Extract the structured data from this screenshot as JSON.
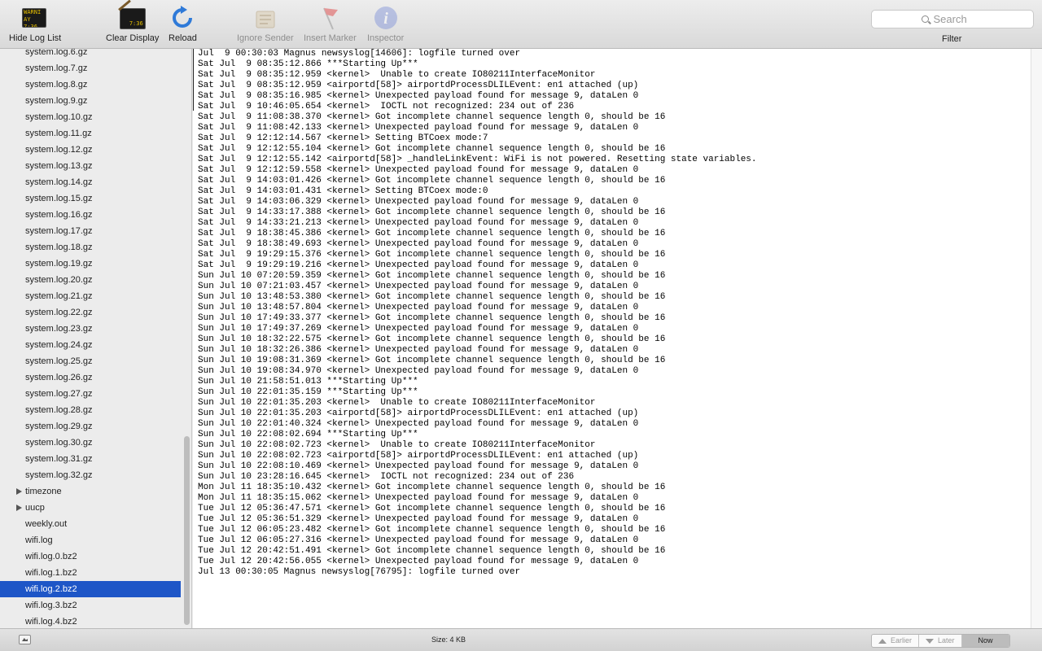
{
  "toolbar": {
    "hide_log_list": "Hide Log List",
    "clear_display": "Clear Display",
    "reload": "Reload",
    "ignore_sender": "Ignore Sender",
    "insert_marker": "Insert Marker",
    "inspector": "Inspector",
    "filter_label": "Filter",
    "search_placeholder": "Search",
    "console_icon_line1": "WARNI",
    "console_icon_line2": "AY 7:36",
    "clear_icon_text": "7:36"
  },
  "sidebar": {
    "items": [
      {
        "label": "system.log.6.gz"
      },
      {
        "label": "system.log.7.gz"
      },
      {
        "label": "system.log.8.gz"
      },
      {
        "label": "system.log.9.gz"
      },
      {
        "label": "system.log.10.gz"
      },
      {
        "label": "system.log.11.gz"
      },
      {
        "label": "system.log.12.gz"
      },
      {
        "label": "system.log.13.gz"
      },
      {
        "label": "system.log.14.gz"
      },
      {
        "label": "system.log.15.gz"
      },
      {
        "label": "system.log.16.gz"
      },
      {
        "label": "system.log.17.gz"
      },
      {
        "label": "system.log.18.gz"
      },
      {
        "label": "system.log.19.gz"
      },
      {
        "label": "system.log.20.gz"
      },
      {
        "label": "system.log.21.gz"
      },
      {
        "label": "system.log.22.gz"
      },
      {
        "label": "system.log.23.gz"
      },
      {
        "label": "system.log.24.gz"
      },
      {
        "label": "system.log.25.gz"
      },
      {
        "label": "system.log.26.gz"
      },
      {
        "label": "system.log.27.gz"
      },
      {
        "label": "system.log.28.gz"
      },
      {
        "label": "system.log.29.gz"
      },
      {
        "label": "system.log.30.gz"
      },
      {
        "label": "system.log.31.gz"
      },
      {
        "label": "system.log.32.gz"
      },
      {
        "label": "timezone"
      },
      {
        "label": "uucp"
      },
      {
        "label": "weekly.out"
      },
      {
        "label": "wifi.log"
      },
      {
        "label": "wifi.log.0.bz2"
      },
      {
        "label": "wifi.log.1.bz2"
      },
      {
        "label": "wifi.log.2.bz2"
      },
      {
        "label": "wifi.log.3.bz2"
      },
      {
        "label": "wifi.log.4.bz2"
      }
    ]
  },
  "log": {
    "lines": [
      "Jul  9 00:30:03 Magnus newsyslog[14606]: logfile turned over",
      "Sat Jul  9 08:35:12.866 ***Starting Up***",
      "Sat Jul  9 08:35:12.959 <kernel>  Unable to create IO80211InterfaceMonitor",
      "Sat Jul  9 08:35:12.959 <airportd[58]> airportdProcessDLILEvent: en1 attached (up)",
      "Sat Jul  9 08:35:16.985 <kernel> Unexpected payload found for message 9, dataLen 0",
      "Sat Jul  9 10:46:05.654 <kernel>  IOCTL not recognized: 234 out of 236",
      "Sat Jul  9 11:08:38.370 <kernel> Got incomplete channel sequence length 0, should be 16",
      "Sat Jul  9 11:08:42.133 <kernel> Unexpected payload found for message 9, dataLen 0",
      "Sat Jul  9 12:12:14.567 <kernel> Setting BTCoex mode:7",
      "Sat Jul  9 12:12:55.104 <kernel> Got incomplete channel sequence length 0, should be 16",
      "Sat Jul  9 12:12:55.142 <airportd[58]> _handleLinkEvent: WiFi is not powered. Resetting state variables.",
      "Sat Jul  9 12:12:59.558 <kernel> Unexpected payload found for message 9, dataLen 0",
      "Sat Jul  9 14:03:01.426 <kernel> Got incomplete channel sequence length 0, should be 16",
      "Sat Jul  9 14:03:01.431 <kernel> Setting BTCoex mode:0",
      "Sat Jul  9 14:03:06.329 <kernel> Unexpected payload found for message 9, dataLen 0",
      "Sat Jul  9 14:33:17.388 <kernel> Got incomplete channel sequence length 0, should be 16",
      "Sat Jul  9 14:33:21.213 <kernel> Unexpected payload found for message 9, dataLen 0",
      "Sat Jul  9 18:38:45.386 <kernel> Got incomplete channel sequence length 0, should be 16",
      "Sat Jul  9 18:38:49.693 <kernel> Unexpected payload found for message 9, dataLen 0",
      "Sat Jul  9 19:29:15.376 <kernel> Got incomplete channel sequence length 0, should be 16",
      "Sat Jul  9 19:29:19.216 <kernel> Unexpected payload found for message 9, dataLen 0",
      "Sun Jul 10 07:20:59.359 <kernel> Got incomplete channel sequence length 0, should be 16",
      "Sun Jul 10 07:21:03.457 <kernel> Unexpected payload found for message 9, dataLen 0",
      "Sun Jul 10 13:48:53.380 <kernel> Got incomplete channel sequence length 0, should be 16",
      "Sun Jul 10 13:48:57.804 <kernel> Unexpected payload found for message 9, dataLen 0",
      "Sun Jul 10 17:49:33.377 <kernel> Got incomplete channel sequence length 0, should be 16",
      "Sun Jul 10 17:49:37.269 <kernel> Unexpected payload found for message 9, dataLen 0",
      "Sun Jul 10 18:32:22.575 <kernel> Got incomplete channel sequence length 0, should be 16",
      "Sun Jul 10 18:32:26.386 <kernel> Unexpected payload found for message 9, dataLen 0",
      "Sun Jul 10 19:08:31.369 <kernel> Got incomplete channel sequence length 0, should be 16",
      "Sun Jul 10 19:08:34.970 <kernel> Unexpected payload found for message 9, dataLen 0",
      "Sun Jul 10 21:58:51.013 ***Starting Up***",
      "Sun Jul 10 22:01:35.159 ***Starting Up***",
      "Sun Jul 10 22:01:35.203 <kernel>  Unable to create IO80211InterfaceMonitor",
      "Sun Jul 10 22:01:35.203 <airportd[58]> airportdProcessDLILEvent: en1 attached (up)",
      "Sun Jul 10 22:01:40.324 <kernel> Unexpected payload found for message 9, dataLen 0",
      "Sun Jul 10 22:08:02.694 ***Starting Up***",
      "Sun Jul 10 22:08:02.723 <kernel>  Unable to create IO80211InterfaceMonitor",
      "Sun Jul 10 22:08:02.723 <airportd[58]> airportdProcessDLILEvent: en1 attached (up)",
      "Sun Jul 10 22:08:10.469 <kernel> Unexpected payload found for message 9, dataLen 0",
      "Sun Jul 10 23:28:16.645 <kernel>  IOCTL not recognized: 234 out of 236",
      "Mon Jul 11 18:35:10.432 <kernel> Got incomplete channel sequence length 0, should be 16",
      "Mon Jul 11 18:35:15.062 <kernel> Unexpected payload found for message 9, dataLen 0",
      "Tue Jul 12 05:36:47.571 <kernel> Got incomplete channel sequence length 0, should be 16",
      "Tue Jul 12 05:36:51.329 <kernel> Unexpected payload found for message 9, dataLen 0",
      "Tue Jul 12 06:05:23.482 <kernel> Got incomplete channel sequence length 0, should be 16",
      "Tue Jul 12 06:05:27.316 <kernel> Unexpected payload found for message 9, dataLen 0",
      "Tue Jul 12 20:42:51.491 <kernel> Got incomplete channel sequence length 0, should be 16",
      "Tue Jul 12 20:42:56.055 <kernel> Unexpected payload found for message 9, dataLen 0",
      "Jul 13 00:30:05 Magnus newsyslog[76795]: logfile turned over"
    ]
  },
  "status": {
    "size": "Size: 4 KB",
    "earlier": "Earlier",
    "later": "Later",
    "now": "Now"
  },
  "colors": {
    "selection": "#1e56c7",
    "info_icon": "#7c8fd8",
    "reload_icon": "#2f7ad8"
  }
}
